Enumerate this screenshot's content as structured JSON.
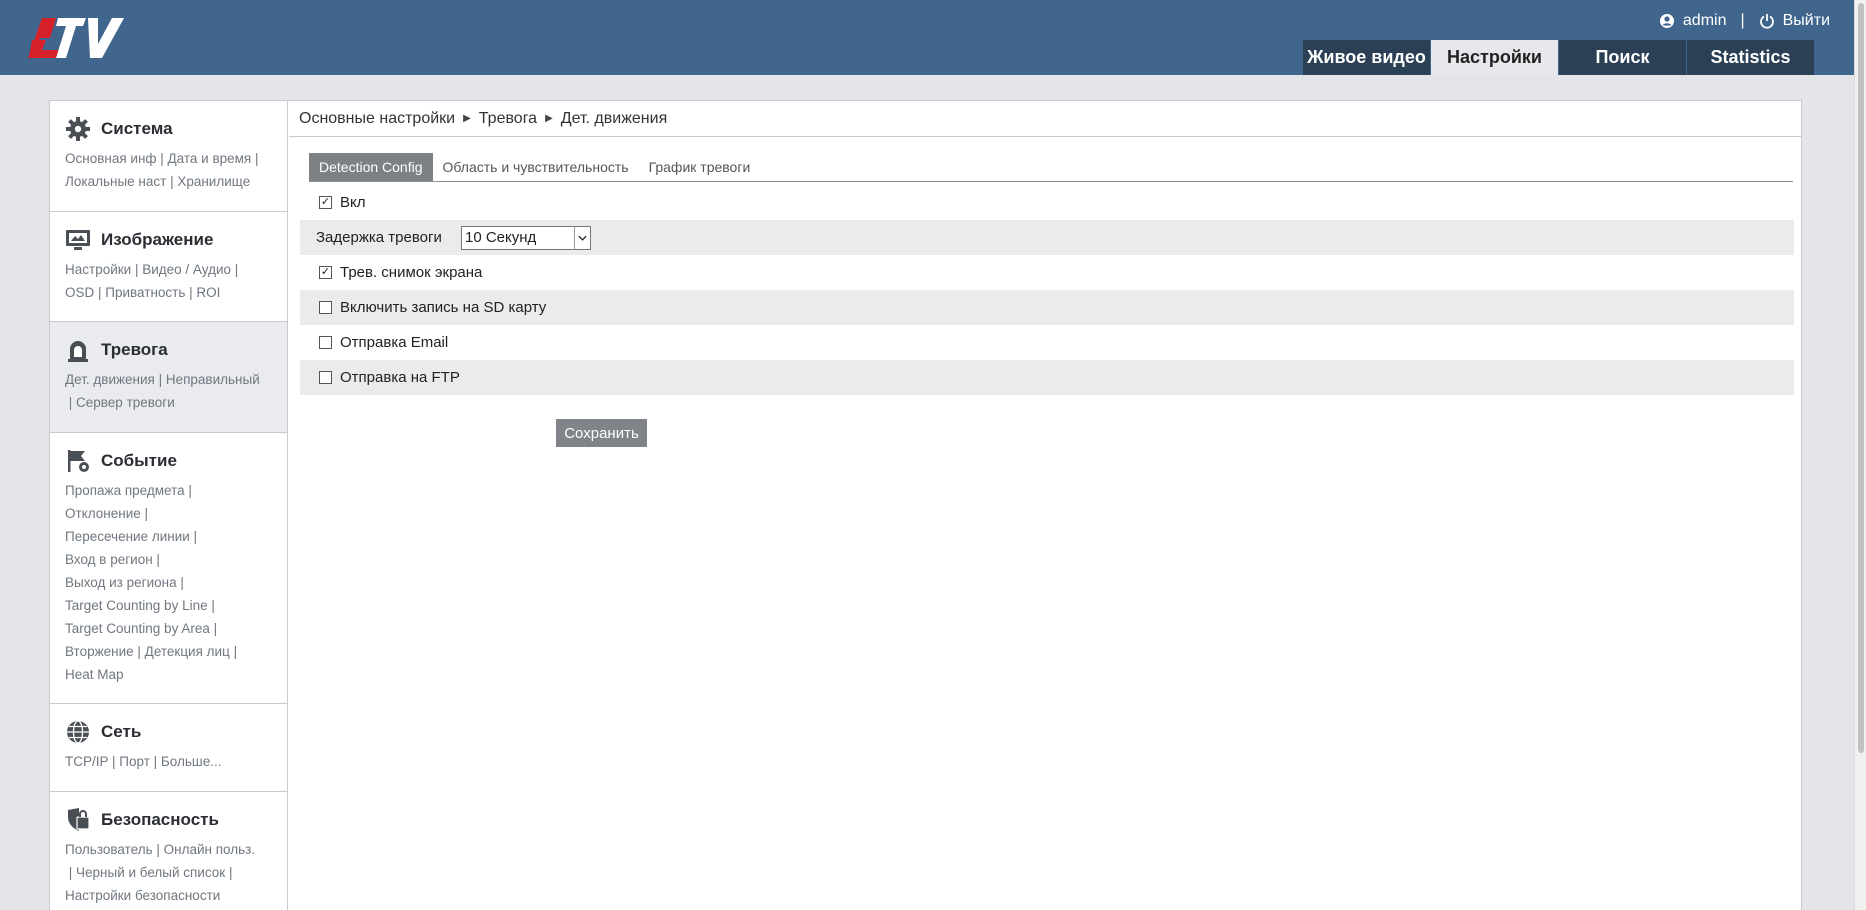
{
  "header": {
    "user": "admin",
    "user_sep": "|",
    "logout": "Выйти",
    "tabs": [
      {
        "label": "Живое видео",
        "active": false
      },
      {
        "label": "Настройки",
        "active": true
      },
      {
        "label": "Поиск",
        "active": false
      },
      {
        "label": "Statistics",
        "active": false
      }
    ]
  },
  "sidebar": {
    "sections": [
      {
        "title": "Система",
        "icon": "gear-icon",
        "links": [
          "Основная инф",
          "Дата и время",
          "Локальные наст",
          "Хранилище"
        ]
      },
      {
        "title": "Изображение",
        "icon": "image-monitor-icon",
        "links": [
          "Настройки",
          "Видео / Аудио",
          "OSD",
          "Приватность",
          "ROI"
        ]
      },
      {
        "title": "Тревога",
        "icon": "alarm-siren-icon",
        "active": true,
        "links": [
          "Дет. движения",
          "Неправильный",
          "Сервер тревоги"
        ]
      },
      {
        "title": "Событие",
        "icon": "event-flag-icon",
        "links": [
          "Пропажа предмета",
          "Отклонение",
          "Пересечение линии",
          "Вход в регион",
          "Выход из региона",
          "Target Counting by Line",
          "Target Counting by Area",
          "Вторжение",
          "Детекция лиц",
          "Heat Map"
        ]
      },
      {
        "title": "Сеть",
        "icon": "globe-icon",
        "links": [
          "TCP/IP",
          "Порт",
          "Больше..."
        ]
      },
      {
        "title": "Безопасность",
        "icon": "shield-icon",
        "links": [
          "Пользователь",
          "Онлайн польз.",
          "Черный и белый список",
          "Настройки безопасности"
        ]
      }
    ]
  },
  "breadcrumb": [
    "Основные настройки",
    "Тревога",
    "Дет. движения"
  ],
  "subtabs": [
    {
      "label": "Detection Config",
      "active": true
    },
    {
      "label": "Область и чувствительность",
      "active": false
    },
    {
      "label": "График тревоги",
      "active": false
    }
  ],
  "form": {
    "enable": {
      "label": "Вкл",
      "checked": true
    },
    "delay": {
      "label": "Задержка тревоги",
      "value": "10 Секунд"
    },
    "snapshot": {
      "label": "Трев. снимок экрана",
      "checked": true
    },
    "sd_record": {
      "label": "Включить запись на SD карту",
      "checked": false
    },
    "email": {
      "label": "Отправка Email",
      "checked": false
    },
    "ftp": {
      "label": "Отправка на FTP",
      "checked": false
    },
    "save_label": "Сохранить"
  }
}
